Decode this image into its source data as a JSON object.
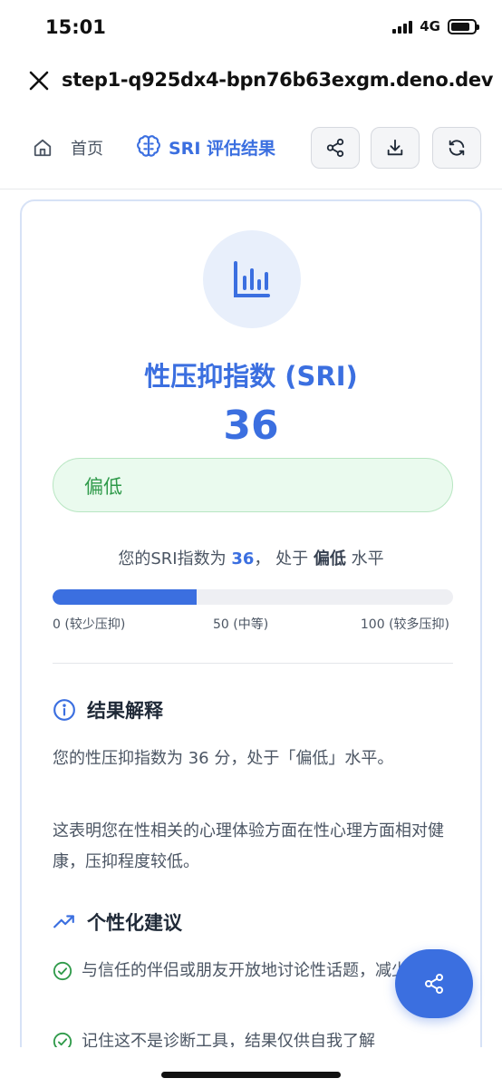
{
  "status": {
    "time": "15:01",
    "network": "4G"
  },
  "browser": {
    "url": "step1-q925dx4-bpn76b63exgm.deno.dev"
  },
  "nav": {
    "home_label": "首页",
    "active_label": "SRI 评估结果"
  },
  "result": {
    "title": "性压抑指数 (SRI)",
    "score": "36",
    "level": "偏低",
    "summary_prefix": "您的SRI指数为",
    "summary_score": "36",
    "summary_mid": "，  处于",
    "summary_level": "偏低",
    "summary_suffix": "水平",
    "progress_percent": 36,
    "scale_min": "0 (较少压抑)",
    "scale_mid": "50 (中等)",
    "scale_max": "100 (较多压抑)"
  },
  "interpretation": {
    "heading": "结果解释",
    "p1": "您的性压抑指数为 36 分，处于「偏低」水平。",
    "p2": "这表明您在性相关的心理体验方面在性心理方面相对健康，压抑程度较低。"
  },
  "advice": {
    "heading": "个性化建议",
    "items": [
      "与信任的伴侣或朋友开放地讨论性话题，减少孤立感。",
      "记住这不是诊断工具，结果仅供自我了解"
    ]
  },
  "colors": {
    "accent": "#3b6fe0",
    "success": "#2f9a4a",
    "badge_bg": "#eafaee"
  }
}
